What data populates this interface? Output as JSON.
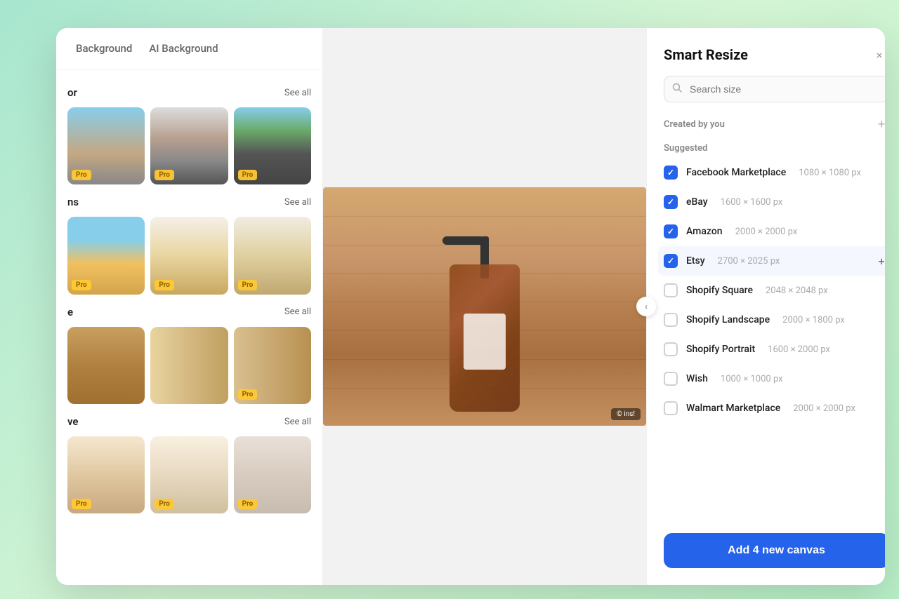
{
  "window": {
    "title": "Smart Resize"
  },
  "sidebar": {
    "tabs": [
      {
        "id": "background",
        "label": "Background",
        "active": false
      },
      {
        "id": "ai-background",
        "label": "AI Background",
        "active": false
      }
    ],
    "sections": [
      {
        "id": "color",
        "title": "or",
        "see_all": "See all",
        "thumbs": [
          "city",
          "paris",
          "road"
        ]
      },
      {
        "id": "patterns",
        "title": "ns",
        "see_all": "See all",
        "thumbs": [
          "arch1",
          "arch2",
          "arch3"
        ]
      },
      {
        "id": "textures",
        "title": "e",
        "see_all": "See all",
        "thumbs": [
          "wood1",
          "wood2",
          "wood3"
        ]
      },
      {
        "id": "rooms",
        "title": "ve",
        "see_all": "See all",
        "thumbs": [
          "room1",
          "room2",
          "room3"
        ]
      }
    ]
  },
  "smart_resize": {
    "title": "Smart Resize",
    "close_label": "×",
    "search": {
      "placeholder": "Search size"
    },
    "created_by_you": {
      "label": "Created by you",
      "add_label": "+"
    },
    "suggested": {
      "label": "Suggested"
    },
    "items": [
      {
        "id": "facebook",
        "name": "Facebook Marketplace",
        "size": "1080 × 1080 px",
        "checked": true,
        "hovered": false
      },
      {
        "id": "ebay",
        "name": "eBay",
        "size": "1600 × 1600 px",
        "checked": true,
        "hovered": false
      },
      {
        "id": "amazon",
        "name": "Amazon",
        "size": "2000 × 2000 px",
        "checked": true,
        "hovered": false
      },
      {
        "id": "etsy",
        "name": "Etsy",
        "size": "2700 × 2025 px",
        "checked": true,
        "hovered": true
      },
      {
        "id": "shopify-square",
        "name": "Shopify Square",
        "size": "2048 × 2048 px",
        "checked": false,
        "hovered": false
      },
      {
        "id": "shopify-landscape",
        "name": "Shopify Landscape",
        "size": "2000 × 1800 px",
        "checked": false,
        "hovered": false
      },
      {
        "id": "shopify-portrait",
        "name": "Shopify Portrait",
        "size": "1600 × 2000 px",
        "checked": false,
        "hovered": false
      },
      {
        "id": "wish",
        "name": "Wish",
        "size": "1000 × 1000 px",
        "checked": false,
        "hovered": false
      },
      {
        "id": "walmart",
        "name": "Walmart Marketplace",
        "size": "2000 × 2000 px",
        "checked": false,
        "hovered": false
      }
    ],
    "footer": {
      "button_label": "Add 4 new canvas"
    }
  },
  "watermark": {
    "text": "© ins!"
  }
}
